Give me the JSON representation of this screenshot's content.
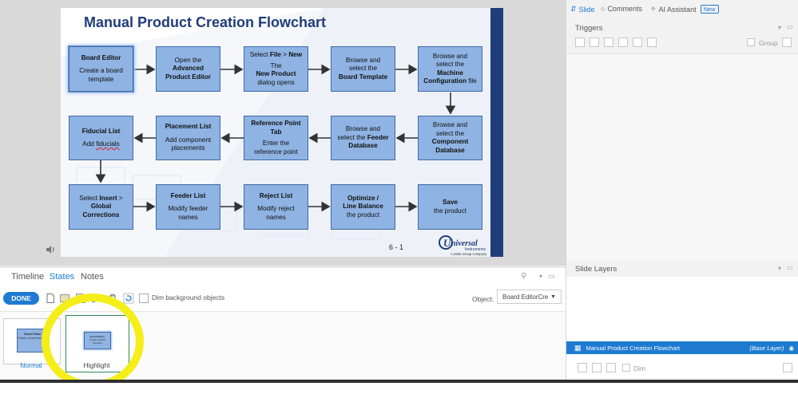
{
  "slide": {
    "title": "Manual Product Creation Flowchart",
    "page_number": "6 - 1",
    "logo_text": "Universal",
    "logo_sub1": "Instruments",
    "logo_sub2": "A Delta Group Company",
    "boxes": {
      "b1": {
        "title": "Board Editor",
        "body": "Create a board template"
      },
      "b2": {
        "l1": "Open the",
        "l2": "Advanced",
        "l3": "Product Editor"
      },
      "b3": {
        "l1a": "Select ",
        "l1b": "File",
        "l1c": " > ",
        "l1d": "New",
        "l2": "The",
        "l3": "New Product",
        "l4": "dialog opens"
      },
      "b4": {
        "l1": "Browse and",
        "l2": "select the",
        "l3": "Board Template"
      },
      "b5": {
        "l1": "Browse and",
        "l2": "select the",
        "l3": "Machine",
        "l4a": "Configuration",
        "l4b": " file"
      },
      "b6": {
        "l1": "Browse and",
        "l2": "select the",
        "l3": "Component",
        "l4": "Database"
      },
      "b7": {
        "l1": "Browse and",
        "l2a": "select the ",
        "l2b": "Feeder",
        "l3": "Database"
      },
      "b8": {
        "title1": "Reference Point",
        "title2": "Tab",
        "l1": "Enter the",
        "l2": "reference point"
      },
      "b9": {
        "title": "Placement List",
        "l1": "Add component",
        "l2": "placements"
      },
      "b10": {
        "title": "Fiducial List",
        "l1a": "Add ",
        "l1b": "fiducials"
      },
      "b11": {
        "l1a": "Select ",
        "l1b": "Insert",
        "l1c": " >",
        "l2": "Global",
        "l3": "Corrections"
      },
      "b12": {
        "title": "Feeder List",
        "l1": "Modify feeder",
        "l2": "names"
      },
      "b13": {
        "title": "Reject List",
        "l1": "Modify reject",
        "l2": "names"
      },
      "b14": {
        "title1": "Optimize /",
        "title2": "Line Balance",
        "l1": "the product"
      },
      "b15": {
        "title": "Save",
        "l1": "the product"
      }
    }
  },
  "bottom": {
    "tabs": [
      "Timeline",
      "States",
      "Notes"
    ],
    "active_tab": "States",
    "done_label": "DONE",
    "dim_label": "Dim background objects",
    "object_label": "Object:",
    "object_value": "Board EditorCre",
    "states": [
      {
        "name": "Normal",
        "thumb_title": "Board Editor",
        "thumb_body": "Create a board template"
      },
      {
        "name": "Highlight",
        "thumb_title": "Board Editor",
        "thumb_body": "Create a board template"
      }
    ]
  },
  "right": {
    "tabs": [
      {
        "label": "Slide",
        "icon": "slide-icon"
      },
      {
        "label": "Comments",
        "icon": "comment-icon"
      },
      {
        "label": "AI Assistant",
        "icon": "sparkle-icon"
      }
    ],
    "new_badge": "New",
    "triggers_title": "Triggers",
    "group_label": "Group",
    "layers_title": "Slide Layers",
    "layer_name": "Manual Product Creation Flowchart",
    "layer_tag": "(Base Layer)",
    "dim_label": "Dim"
  },
  "colors": {
    "accent": "#1f7bd1",
    "box_fill": "#8fb3e3",
    "box_border": "#3f6aa8",
    "title": "#1f3d7a",
    "highlight_ring": "#f5ee18"
  }
}
